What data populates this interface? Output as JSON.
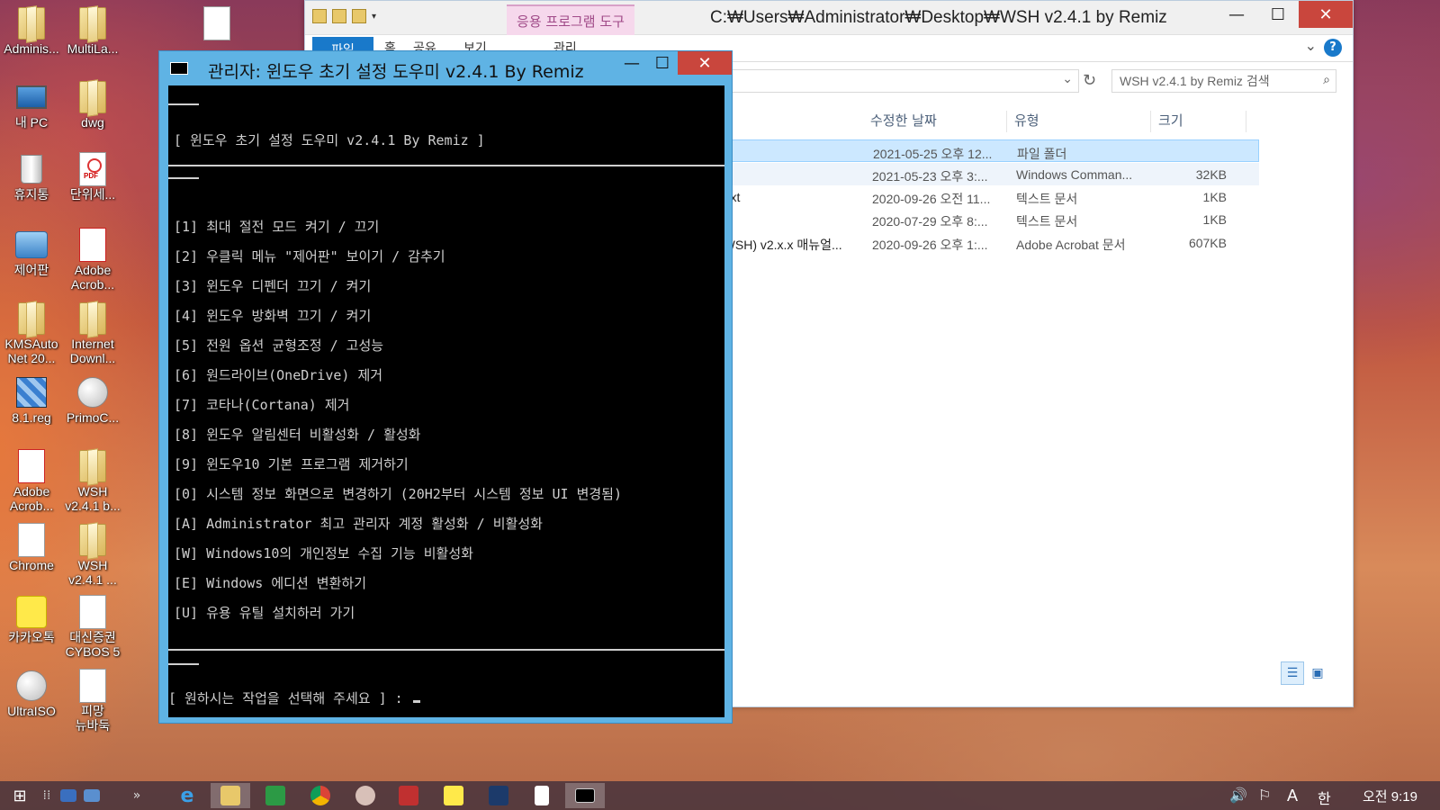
{
  "desktop": {
    "icons": [
      {
        "label": "Adminis...",
        "icon": "user-folder-icon"
      },
      {
        "label": "MultiLa...",
        "icon": "folder-icon"
      },
      {
        "label": "내 PC",
        "icon": "computer-icon"
      },
      {
        "label": "dwg",
        "icon": "folder-icon"
      },
      {
        "label": "휴지통",
        "icon": "recycle-bin-icon"
      },
      {
        "label": "단위세...",
        "icon": "pdf-icon"
      },
      {
        "label": "제어판",
        "icon": "control-panel-icon"
      },
      {
        "label": "Adobe\nAcrob...",
        "icon": "acrobat-icon"
      },
      {
        "label": "KMSAuto\nNet 20...",
        "icon": "folder-icon"
      },
      {
        "label": "Internet\nDownl...",
        "icon": "folder-icon"
      },
      {
        "label": "8.1.reg",
        "icon": "registry-icon"
      },
      {
        "label": "PrimoC...",
        "icon": "app-icon"
      },
      {
        "label": "Adobe\nAcrob...",
        "icon": "acrobat-icon"
      },
      {
        "label": "WSH\nv2.4.1 b...",
        "icon": "folder-icon"
      },
      {
        "label": "Chrome",
        "icon": "chrome-icon"
      },
      {
        "label": "WSH\nv2.4.1 ...",
        "icon": "folder-icon"
      },
      {
        "label": "카카오톡",
        "icon": "kakaotalk-icon"
      },
      {
        "label": "대신증권\nCYBOS 5",
        "icon": "app-icon"
      },
      {
        "label": "UltraISO",
        "icon": "disc-icon"
      },
      {
        "label": "피망\n뉴바둑",
        "icon": "app-icon"
      }
    ]
  },
  "explorer": {
    "title": "C:₩Users₩Administrator₩Desktop₩WSH v2.4.1 by Remiz",
    "app_tools_tab": "응용 프로그램 도구",
    "ribbon_tabs": [
      "파일",
      "홈",
      "공유",
      "보기",
      "관리"
    ],
    "search_placeholder": "WSH v2.4.1 by Remiz 검색",
    "columns": [
      "수정한 날짜",
      "유형",
      "크기"
    ],
    "rows": [
      {
        "name": "",
        "date": "2021-05-25 오후 12...",
        "type": "파일 폴더",
        "size": ""
      },
      {
        "name": "",
        "date": "2021-05-23 오후 3:...",
        "type": "Windows Comman...",
        "size": "32KB"
      },
      {
        "name": "-.txt",
        "date": "2020-09-26 오전 11...",
        "type": "텍스트 문서",
        "size": "1KB"
      },
      {
        "name": "",
        "date": "2020-07-29 오후 8:...",
        "type": "텍스트 문서",
        "size": "1KB"
      },
      {
        "name": "(WSH) v2.x.x 매뉴얼...",
        "date": "2020-09-26 오후 1:...",
        "type": "Adobe Acrobat 문서",
        "size": "607KB"
      }
    ]
  },
  "console": {
    "title": "관리자:  윈도우 초기 설정 도우미 v2.4.1 By Remiz",
    "header": "[ 윈도우 초기 설정 도우미 v2.4.1 By Remiz ]",
    "menu": [
      "[1] 최대 절전 모드 켜기 / 끄기",
      "[2] 우클릭 메뉴 \"제어판\" 보이기 / 감추기",
      "[3] 윈도우 디펜더 끄기 / 켜기",
      "[4] 윈도우 방화벽 끄기 / 켜기",
      "[5] 전원 옵션 균형조정 / 고성능",
      "[6] 원드라이브(OneDrive) 제거",
      "[7] 코타나(Cortana) 제거",
      "[8] 윈도우 알림센터 비활성화 / 활성화",
      "[9] 윈도우10 기본 프로그램 제거하기",
      "[0] 시스템 정보 화면으로 변경하기 (20H2부터 시스템 정보 UI 변경됨)",
      "[A] Administrator 최고 관리자 계정 활성화 / 비활성화",
      "[W] Windows10의 개인정보 수집 기능 비활성화",
      "[E] Windows 에디션 변환하기",
      "[U] 유용 유틸 설치하러 가기"
    ],
    "prompt": "[ 원하시는 작업을 선택해 주세요 ] : "
  },
  "taskbar": {
    "apps": [
      "start-icon",
      "task-view-icon",
      "desktop-icon",
      "monitor-icon",
      "ie-icon",
      "file-explorer-icon",
      "store-icon",
      "chrome-icon",
      "app-icon",
      "app-icon",
      "kakaotalk-icon",
      "app-icon",
      "notepad-icon",
      "console-icon"
    ],
    "ime_mode": "A",
    "ime_lang": "한",
    "clock": "오전 9:19"
  }
}
